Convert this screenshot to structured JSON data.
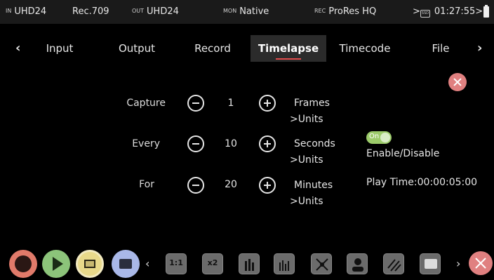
{
  "status": {
    "in_tag": "IN",
    "in_value": "UHD24",
    "colorspace": "Rec.709",
    "out_tag": "OUT",
    "out_value": "UHD24",
    "mon_tag": "MON",
    "mon_value": "Native",
    "rec_tag": "REC",
    "rec_value": "ProRes HQ",
    "media_tag": "SSD",
    "timecode": "01:27:55"
  },
  "tabs": [
    {
      "label": "Input"
    },
    {
      "label": "Output"
    },
    {
      "label": "Record"
    },
    {
      "label": "Timelapse"
    },
    {
      "label": "Timecode"
    },
    {
      "label": "File"
    }
  ],
  "rows": [
    {
      "label": "Capture",
      "value": "1",
      "unit": "Frames",
      "units_link": ">Units"
    },
    {
      "label": "Every",
      "value": "10",
      "unit": "Seconds",
      "units_link": ">Units"
    },
    {
      "label": "For",
      "value": "20",
      "unit": "Minutes",
      "units_link": ">Units"
    }
  ],
  "toggle": {
    "label": "On",
    "state": "on"
  },
  "enable_label": "Enable/Disable",
  "play_time": "Play Time:00:00:05:00",
  "toolbar": {
    "tools": [
      "1:1",
      "x2",
      "",
      "",
      "",
      "",
      "",
      ""
    ]
  },
  "colors": {
    "accent": "#e14b4b",
    "toggle_on": "#9ccb6a",
    "close": "#e08080",
    "record": "#e07a6a",
    "play": "#8cc47a",
    "monitor": "#e8d98a",
    "overlay": "#a9b8e8"
  }
}
